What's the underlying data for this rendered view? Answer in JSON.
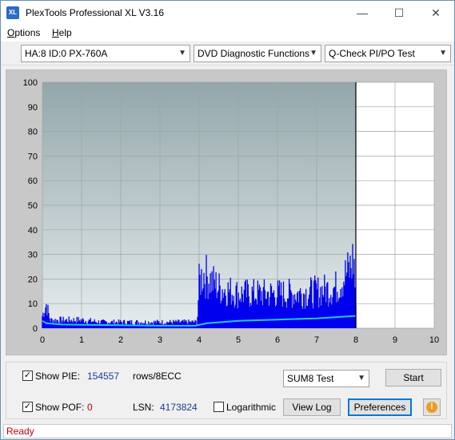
{
  "window": {
    "title": "PlexTools Professional XL V3.16",
    "icon_text": "XL"
  },
  "window_controls": {
    "minimize": "—",
    "maximize": "☐",
    "close": "✕"
  },
  "menu": {
    "options_hot": "O",
    "options_rest": "ptions",
    "help_hot": "H",
    "help_rest": "elp"
  },
  "toolbar": {
    "drive": "HA:8 ID:0  PX-760A",
    "function": "DVD Diagnostic Functions",
    "test": "Q-Check PI/PO Test"
  },
  "chart_data": {
    "type": "area",
    "x_ticks": [
      "0",
      "1",
      "2",
      "3",
      "4",
      "5",
      "6",
      "7",
      "8",
      "9",
      "10"
    ],
    "y_ticks": [
      "0",
      "10",
      "20",
      "30",
      "40",
      "50",
      "60",
      "70",
      "80",
      "90",
      "100"
    ],
    "xlim": [
      0,
      10
    ],
    "ylim": [
      0,
      100
    ],
    "grid": true,
    "marker_x": 8,
    "series": [
      {
        "color": "#0000ee",
        "style": "bars",
        "points": [
          [
            0,
            6
          ],
          [
            0.1,
            12
          ],
          [
            0.2,
            4
          ],
          [
            0.5,
            4
          ],
          [
            1,
            4
          ],
          [
            1.5,
            3
          ],
          [
            2,
            3
          ],
          [
            2.5,
            3
          ],
          [
            3,
            3
          ],
          [
            3.5,
            3
          ],
          [
            3.95,
            3
          ],
          [
            4.0,
            22
          ],
          [
            4.1,
            27
          ],
          [
            4.5,
            20
          ],
          [
            5,
            17
          ],
          [
            5.5,
            17
          ],
          [
            6,
            17
          ],
          [
            6.5,
            17
          ],
          [
            7,
            18
          ],
          [
            7.5,
            20
          ],
          [
            7.85,
            29
          ],
          [
            7.95,
            35
          ],
          [
            8,
            12
          ]
        ]
      },
      {
        "color": "#22c8e8",
        "style": "line",
        "points": [
          [
            0,
            3
          ],
          [
            0.1,
            2
          ],
          [
            0.5,
            1.5
          ],
          [
            1,
            1.4
          ],
          [
            2,
            1.2
          ],
          [
            3,
            1.0
          ],
          [
            3.9,
            1.0
          ],
          [
            4.2,
            2
          ],
          [
            5,
            3
          ],
          [
            6,
            3.5
          ],
          [
            7,
            4
          ],
          [
            7.5,
            4.5
          ],
          [
            8,
            5
          ]
        ]
      }
    ]
  },
  "controls": {
    "show_pie_label": "Show PIE:",
    "show_pie_checked": "✓",
    "pie_value": "154557",
    "rows_label": "rows/8ECC",
    "show_pof_label": "Show POF:",
    "show_pof_checked": "✓",
    "pof_value": "0",
    "lsn_label": "LSN:",
    "lsn_value": "4173824",
    "logarithmic_label": "Logarithmic",
    "sum_select": "SUM8 Test",
    "start_button": "Start",
    "view_log_button": "View Log",
    "preferences_button": "Preferences",
    "info_glyph": "i"
  },
  "status": {
    "text": "Ready"
  }
}
